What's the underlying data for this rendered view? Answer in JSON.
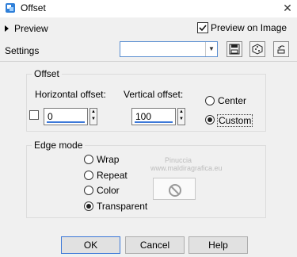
{
  "window": {
    "title": "Offset",
    "close_label": "✕"
  },
  "preview": {
    "label": "Preview",
    "preview_on_image_label": "Preview on Image",
    "preview_on_image_checked": true
  },
  "settings": {
    "label": "Settings",
    "value": ""
  },
  "offset_group": {
    "title": "Offset",
    "horizontal_label": "Horizontal offset:",
    "horizontal_value": "0",
    "vertical_label": "Vertical offset:",
    "vertical_value": "100",
    "center_label": "Center",
    "custom_label": "Custom",
    "selected": "Custom"
  },
  "edge_group": {
    "title": "Edge mode",
    "options": [
      "Wrap",
      "Repeat",
      "Color",
      "Transparent"
    ],
    "selected": "Transparent"
  },
  "buttons": {
    "ok": "OK",
    "cancel": "Cancel",
    "help": "Help"
  },
  "watermark": {
    "line1": "Pinuccia",
    "line2": "www.maldiragrafica.eu"
  },
  "colors": {
    "accent": "#3c78d8",
    "background": "#f0f0f0"
  }
}
